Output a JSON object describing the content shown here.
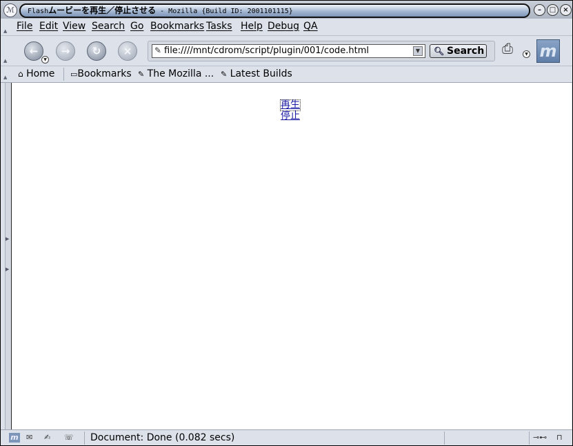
{
  "window": {
    "title_prefix": "Flash",
    "title_main": "ムービーを再生／停止させる",
    "title_suffix": " - Mozilla {Build ID: 2001101115}",
    "minimize_glyph": "–",
    "maximize_glyph": "□",
    "close_glyph": "×"
  },
  "menubar": {
    "items": [
      "File",
      "Edit",
      "View",
      "Search",
      "Go",
      "Bookmarks",
      "Tasks",
      "Help",
      "Debug",
      "QA"
    ]
  },
  "navbar": {
    "back_glyph": "←",
    "forward_glyph": "→",
    "reload_glyph": "↻",
    "stop_glyph": "×",
    "url": "file:////mnt/cdrom/script/plugin/001/code.html",
    "search_label": "Search"
  },
  "personalbar": {
    "home": "Home",
    "bookmarks": "Bookmarks",
    "mozilla": "The Mozilla ...",
    "latest_builds": "Latest Builds"
  },
  "content": {
    "play_link": "再生",
    "stop_link": "停止"
  },
  "statusbar": {
    "text": "Document: Done (0.082 secs)"
  },
  "icons": {
    "app": "mozilla-logo-icon",
    "page": "page-icon",
    "search": "magnifier-icon",
    "home": "house-icon",
    "folder": "folder-icon",
    "bookmark": "bookmark-icon",
    "mail": "mail-icon",
    "composer": "composer-icon",
    "chatzilla": "chat-icon",
    "online": "plug-icon",
    "security": "padlock-icon"
  },
  "colors": {
    "chrome": "#dde2ea",
    "link": "#1a1aa6",
    "title_pill": "#9fb3cf"
  }
}
